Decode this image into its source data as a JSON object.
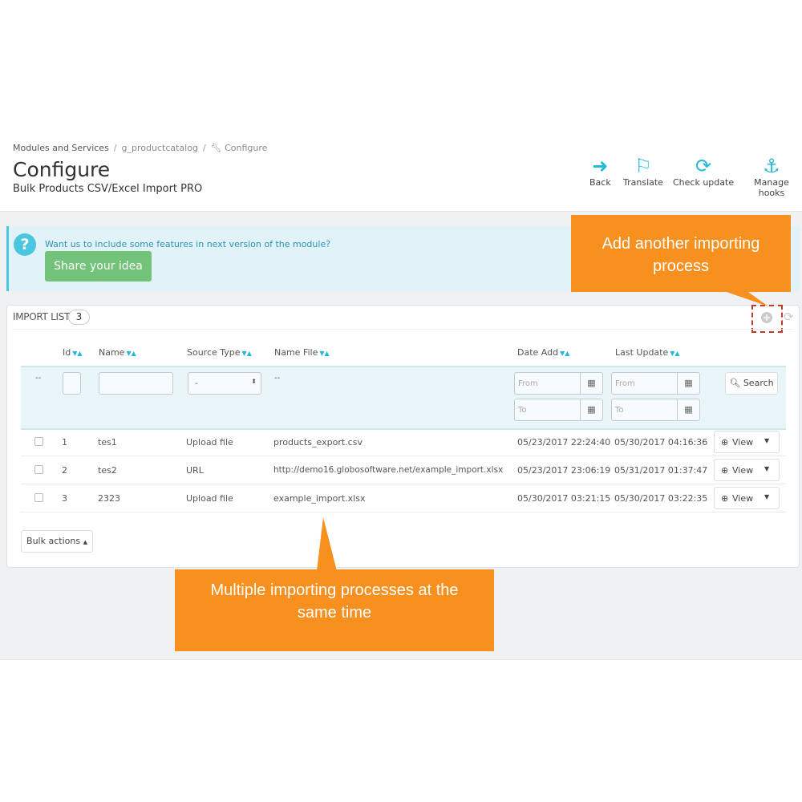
{
  "breadcrumb": [
    "Modules and Services",
    "g_productcatalog",
    "Configure"
  ],
  "header": {
    "title": "Configure",
    "subtitle": "Bulk Products CSV/Excel Import PRO"
  },
  "toolbar": [
    {
      "label": "Back",
      "icon": "arrow-circle-left-icon"
    },
    {
      "label": "Translate",
      "icon": "flag-icon"
    },
    {
      "label": "Check update",
      "icon": "refresh-icon"
    },
    {
      "label": "Manage hooks",
      "icon": "anchor-icon"
    }
  ],
  "info": {
    "text": "Want us to include some features in next version of the module?",
    "button": "Share your idea"
  },
  "panel": {
    "title": "IMPORT LIST",
    "count": "3"
  },
  "columns": [
    "Id",
    "Name",
    "Source Type",
    "Name File",
    "Date Add",
    "Last Update"
  ],
  "filters": {
    "empty": "--",
    "source_select": "-",
    "name_file": "--",
    "from": "From",
    "to": "To",
    "search": "Search"
  },
  "rows": [
    {
      "id": "1",
      "name": "tes1",
      "source": "Upload file",
      "file": "products_export.csv",
      "date_add": "05/23/2017 22:24:40",
      "last_update": "05/30/2017 04:16:36"
    },
    {
      "id": "2",
      "name": "tes2",
      "source": "URL",
      "file": "http://demo16.globosoftware.net/example_import.xlsx",
      "date_add": "05/23/2017 23:06:19",
      "last_update": "05/31/2017 01:37:47"
    },
    {
      "id": "3",
      "name": "2323",
      "source": "Upload file",
      "file": "example_import.xlsx",
      "date_add": "05/30/2017 03:21:15",
      "last_update": "05/30/2017 03:22:35"
    }
  ],
  "view_label": "View",
  "bulk_actions": "Bulk actions",
  "callouts": {
    "add": "Add another importing process",
    "multiple": "Multiple importing processes at the same time"
  },
  "colors": {
    "accent": "#25b9d7",
    "callout": "#f7901e",
    "share": "#72c279"
  }
}
